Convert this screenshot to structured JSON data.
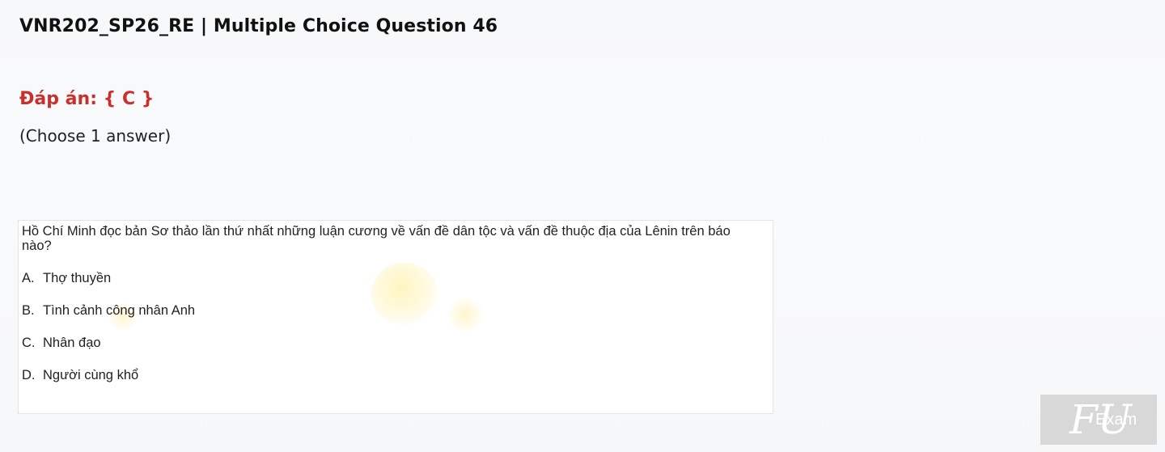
{
  "header": {
    "title": "VNR202_SP26_RE | Multiple Choice Question 46"
  },
  "answer": {
    "label": "Đáp án: { C }",
    "color": "#c9302c"
  },
  "instruction": "(Choose 1 answer)",
  "question": {
    "text": "Hồ Chí Minh đọc bản Sơ thảo lần thứ nhất những luận cương về vấn đề dân tộc và vấn đề thuộc địa của Lênin trên báo nào?",
    "options": [
      {
        "letter": "A.",
        "text": "Thợ thuyền"
      },
      {
        "letter": "B.",
        "text": "Tình cảnh công nhân Anh"
      },
      {
        "letter": "C.",
        "text": "Nhân đạo"
      },
      {
        "letter": "D.",
        "text": "Người cùng khổ"
      }
    ]
  },
  "logo": {
    "mark": "FU",
    "word": "Exam"
  }
}
